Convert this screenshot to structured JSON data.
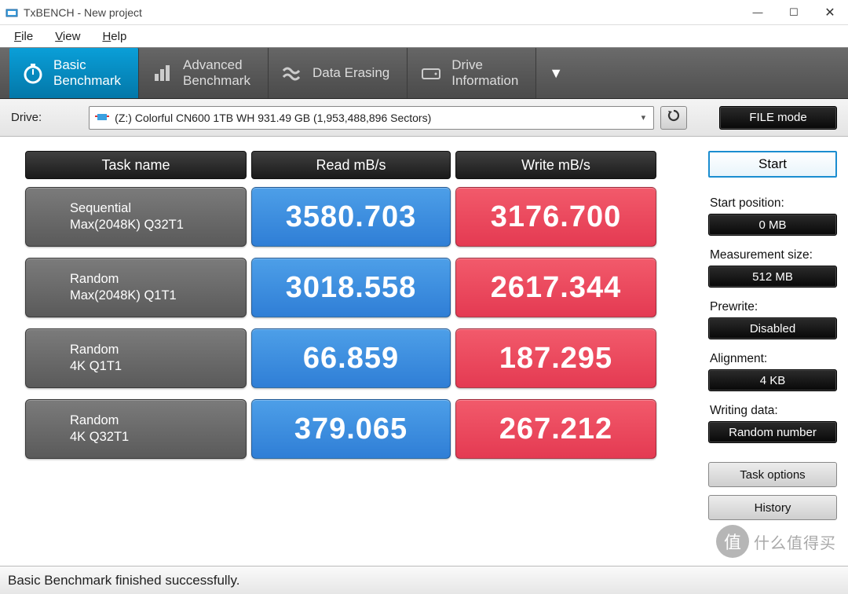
{
  "window": {
    "title": "TxBENCH - New project"
  },
  "menu": {
    "file": "File",
    "view": "View",
    "help": "Help"
  },
  "tabs": {
    "basic": "Basic\nBenchmark",
    "advanced": "Advanced\nBenchmark",
    "erasing": "Data Erasing",
    "driveinfo": "Drive\nInformation"
  },
  "toolbar": {
    "drive_label": "Drive:",
    "drive_value": "(Z:) Colorful CN600 1TB WH  931.49 GB (1,953,488,896 Sectors)",
    "filemode": "FILE mode"
  },
  "headers": {
    "task": "Task name",
    "read": "Read mB/s",
    "write": "Write mB/s"
  },
  "rows": [
    {
      "name1": "Sequential",
      "name2": "Max(2048K) Q32T1",
      "read": "3580.703",
      "write": "3176.700"
    },
    {
      "name1": "Random",
      "name2": "Max(2048K) Q1T1",
      "read": "3018.558",
      "write": "2617.344"
    },
    {
      "name1": "Random",
      "name2": "4K Q1T1",
      "read": "66.859",
      "write": "187.295"
    },
    {
      "name1": "Random",
      "name2": "4K Q32T1",
      "read": "379.065",
      "write": "267.212"
    }
  ],
  "sidebar": {
    "start": "Start",
    "start_pos_label": "Start position:",
    "start_pos": "0 MB",
    "meas_label": "Measurement size:",
    "meas": "512 MB",
    "prewrite_label": "Prewrite:",
    "prewrite": "Disabled",
    "align_label": "Alignment:",
    "align": "4 KB",
    "wdata_label": "Writing data:",
    "wdata": "Random number",
    "task_options": "Task options",
    "history": "History"
  },
  "status": "Basic Benchmark finished successfully.",
  "watermark": "什么值得买"
}
